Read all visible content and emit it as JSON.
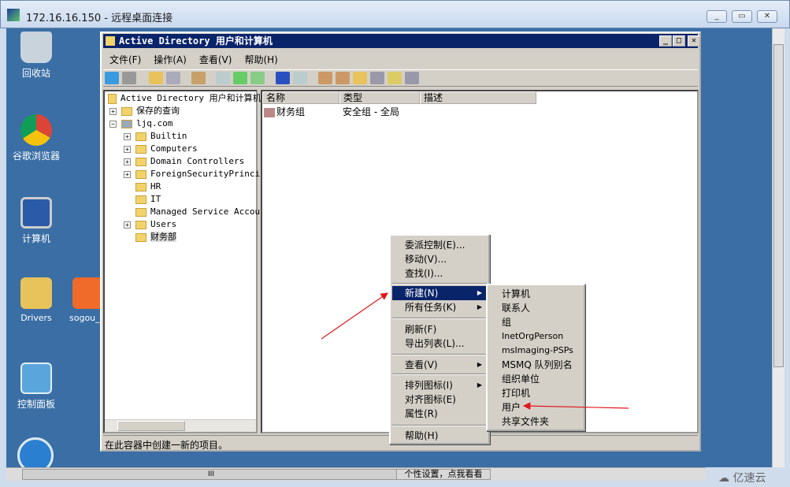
{
  "rdp": {
    "title": "172.16.16.150 - 远程桌面连接",
    "controls": [
      "minimize",
      "restore",
      "close"
    ]
  },
  "desktop": {
    "icons": [
      {
        "label": "回收站",
        "icon": "recycle-bin-icon"
      },
      {
        "label": "谷歌浏览器",
        "icon": "chrome-icon"
      },
      {
        "label": "计算机",
        "icon": "computer-icon"
      },
      {
        "label": "Drivers",
        "icon": "folder-icon"
      },
      {
        "label": "sogou_",
        "icon": "sogou-icon"
      },
      {
        "label": "控制面板",
        "icon": "control-panel-icon"
      }
    ]
  },
  "mmc": {
    "title": "Active Directory 用户和计算机",
    "menu": [
      "文件(F)",
      "操作(A)",
      "查看(V)",
      "帮助(H)"
    ],
    "tree": {
      "root": "Active Directory 用户和计算机",
      "saved": "保存的查询",
      "domain": "ljq.com",
      "children": [
        "Builtin",
        "Computers",
        "Domain Controllers",
        "ForeignSecurityPrincip",
        "HR",
        "IT",
        "Managed Service Accour",
        "Users",
        "财务部"
      ]
    },
    "columns": [
      "名称",
      "类型",
      "描述"
    ],
    "rows": [
      {
        "name": "财务组",
        "type": "安全组 - 全局",
        "desc": ""
      }
    ],
    "status": "在此容器中创建一新的项目。"
  },
  "context_menu": {
    "items": [
      "委派控制(E)...",
      "移动(V)...",
      "查找(I)...",
      "新建(N)",
      "所有任务(K)",
      "刷新(F)",
      "导出列表(L)...",
      "查看(V)",
      "排列图标(I)",
      "对齐图标(E)",
      "属性(R)",
      "帮助(H)"
    ],
    "selected": "新建(N)"
  },
  "submenu": {
    "items": [
      "计算机",
      "联系人",
      "组",
      "InetOrgPerson",
      "msImaging-PSPs",
      "MSMQ 队列别名",
      "组织单位",
      "打印机",
      "用户",
      "共享文件夹"
    ]
  },
  "taskbar": {
    "center": "个性设置，点我看看",
    "scroll_grip": "III"
  },
  "watermark": "亿速云",
  "colors": {
    "desktop": "#3a6ea5",
    "title_active": "#0a246a",
    "annotation_arrow": "#e0161b"
  }
}
